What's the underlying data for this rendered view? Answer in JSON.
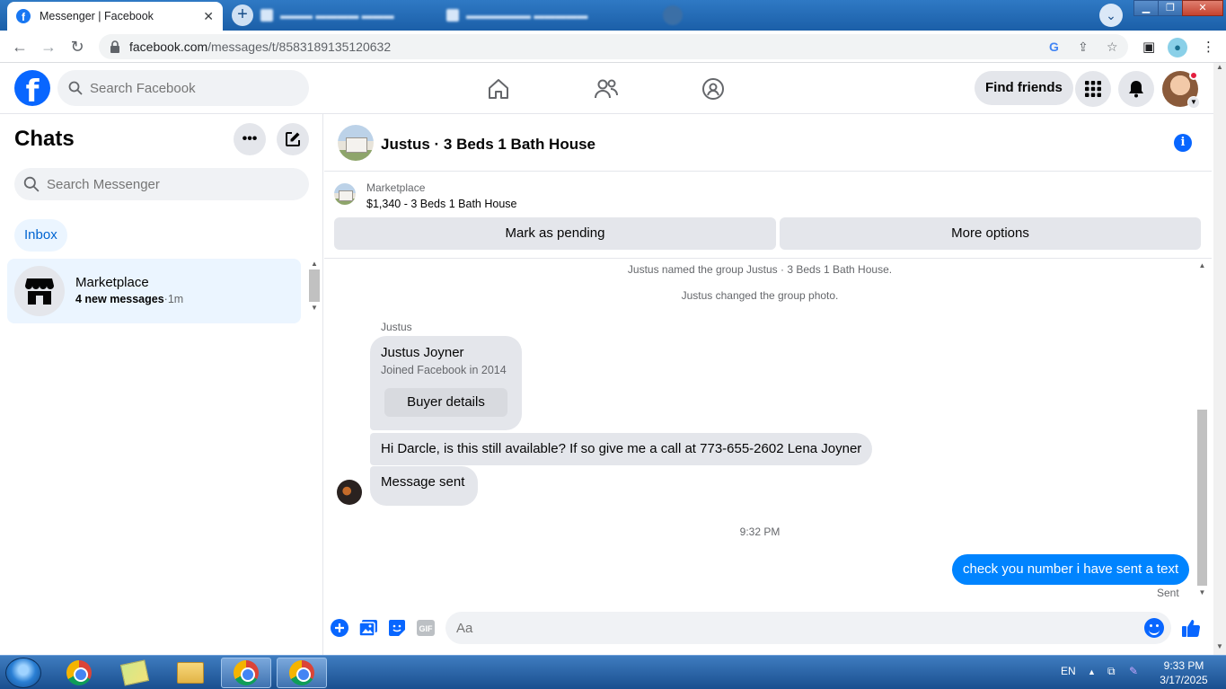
{
  "browser": {
    "active_tab_title": "Messenger | Facebook",
    "url_host": "facebook.com",
    "url_path": "/messages/t/8583189135120632"
  },
  "fb_header": {
    "search_placeholder": "Search Facebook",
    "find_friends_label": "Find friends",
    "brand_color": "#0866ff"
  },
  "sidebar": {
    "title": "Chats",
    "search_placeholder": "Search Messenger",
    "filter_label": "Inbox",
    "chats": [
      {
        "name": "Marketplace",
        "preview": "4 new messages",
        "separator": "·",
        "time": "1m"
      }
    ]
  },
  "conversation": {
    "title": "Justus · 3 Beds 1 Bath House",
    "marketplace": {
      "label": "Marketplace",
      "listing": "$1,340 - 3 Beds 1 Bath House",
      "mark_pending_label": "Mark as pending",
      "more_options_label": "More options"
    },
    "system_messages": [
      "Justus named the group Justus · 3 Beds 1 Bath House.",
      "Justus changed the group photo."
    ],
    "sender_name": "Justus",
    "profile_card": {
      "name": "Justus Joyner",
      "subtitle": "Joined Facebook in 2014",
      "button_label": "Buyer details"
    },
    "incoming_messages": [
      "Hi Darcle, is this still available? If so give me a call at 773-655-2602 Lena Joyner",
      "Message sent"
    ],
    "timestamp": "9:32 PM",
    "outgoing_message": "check you number i have sent a text",
    "outgoing_status": "Sent",
    "outgoing_color": "#0084ff"
  },
  "composer": {
    "placeholder": "Aa",
    "gif_label": "GIF"
  },
  "taskbar": {
    "language": "EN",
    "time": "9:33 PM",
    "date": "3/17/2025"
  }
}
